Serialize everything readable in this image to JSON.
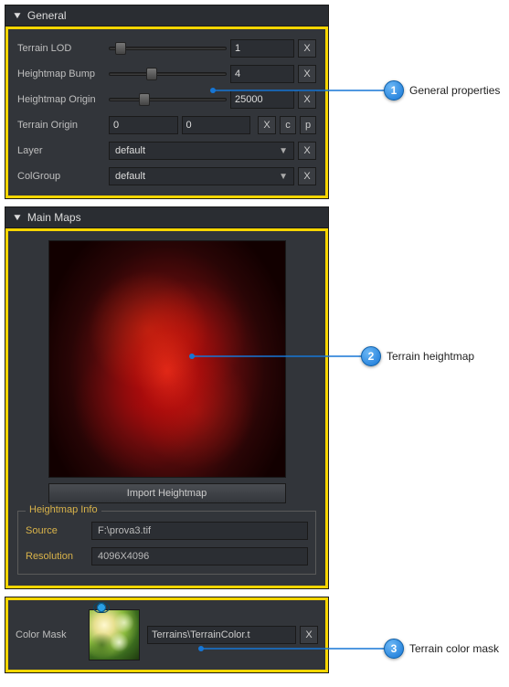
{
  "general": {
    "title": "General",
    "rows": {
      "lod": {
        "label": "Terrain LOD",
        "value": "1",
        "min": 0,
        "max": 10,
        "pos": 5,
        "reset": "X"
      },
      "bump": {
        "label": "Heightmap Bump",
        "value": "4",
        "min": 0,
        "max": 10,
        "pos": 35,
        "reset": "X"
      },
      "hOrigin": {
        "label": "Heightmap Origin",
        "value": "25000",
        "min": 0,
        "max": 100000,
        "pos": 28,
        "reset": "X"
      },
      "tOrigin": {
        "label": "Terrain Origin",
        "x": "0",
        "y": "0",
        "reset": "X",
        "c": "c",
        "p": "p"
      },
      "layer": {
        "label": "Layer",
        "value": "default",
        "reset": "X"
      },
      "colgroup": {
        "label": "ColGroup",
        "value": "default",
        "reset": "X"
      }
    }
  },
  "mainmaps": {
    "title": "Main Maps",
    "import_btn": "Import Heightmap",
    "info": {
      "legend": "Heightmap Info",
      "source_label": "Source",
      "source_value": "F:\\prova3.tif",
      "res_label": "Resolution",
      "res_value": "4096X4096"
    }
  },
  "colormask": {
    "label": "Color Mask",
    "path": "Terrains\\TerrainColor.t",
    "reset": "X"
  },
  "callouts": {
    "c1": {
      "num": "1",
      "text": "General properties"
    },
    "c2": {
      "num": "2",
      "text": "Terrain heightmap"
    },
    "c3": {
      "num": "3",
      "text": "Terrain color mask"
    }
  }
}
